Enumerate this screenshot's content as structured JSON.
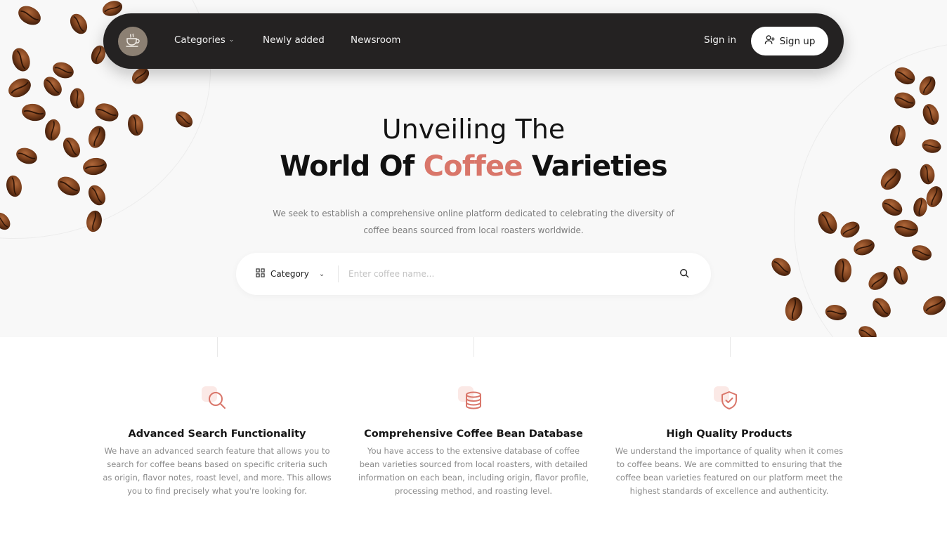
{
  "colors": {
    "accent": "#d9766a",
    "navbar": "#242222",
    "hero_bg": "#f8f8f8"
  },
  "nav": {
    "logo_icon": "coffee-cup-icon",
    "categories_label": "Categories",
    "newly_added_label": "Newly added",
    "newsroom_label": "Newsroom",
    "signin_label": "Sign in",
    "signup_label": "Sign up"
  },
  "hero": {
    "headline_line1": "Unveiling The",
    "headline_pre": "World Of ",
    "headline_accent": "Coffee",
    "headline_post": " Varieties",
    "subtext": "We seek to establish a comprehensive online platform dedicated to celebrating the diversity of coffee beans sourced from local roasters worldwide."
  },
  "search": {
    "category_label": "Category",
    "placeholder": "Enter coffee name..."
  },
  "features": [
    {
      "icon": "search-icon",
      "title": "Advanced Search Functionality",
      "desc": "We have an advanced search feature that allows you to search for coffee beans based on specific criteria such as origin, flavor notes, roast level, and more. This allows you to find precisely what you're looking for."
    },
    {
      "icon": "database-icon",
      "title": "Comprehensive Coffee Bean Database",
      "desc": "You have access to the extensive database of coffee bean varieties sourced from local roasters, with detailed information on each bean, including origin, flavor profile, processing method, and roasting level."
    },
    {
      "icon": "shield-check-icon",
      "title": "High Quality Products",
      "desc": "We understand the importance of quality when it comes to coffee beans. We are committed to ensuring that the coffee bean varieties featured on our platform meet the highest standards of excellence and authenticity."
    }
  ]
}
